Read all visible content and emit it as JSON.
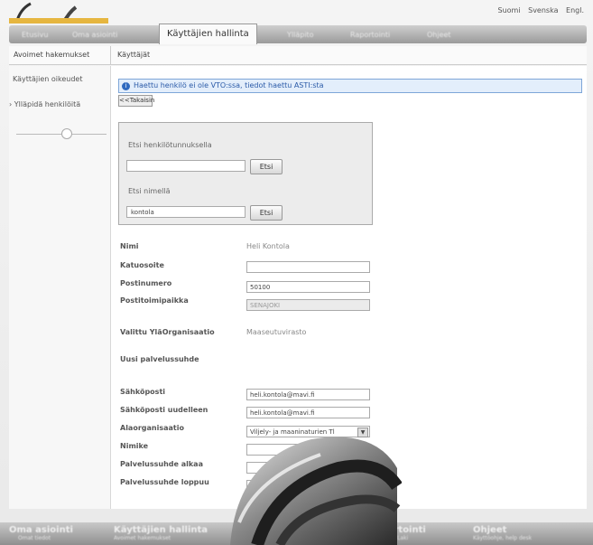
{
  "header": {
    "languages": [
      "Suomi",
      "Svenska",
      "Engl."
    ]
  },
  "tabs": [
    {
      "label": "Etusivu",
      "active": false
    },
    {
      "label": "Oma asiointi",
      "active": false
    },
    {
      "label": "Käyttäjien hallinta",
      "active": true
    },
    {
      "label": "Ylläpito",
      "active": false
    },
    {
      "label": "Raportointi",
      "active": false
    },
    {
      "label": "Ohjeet",
      "active": false
    }
  ],
  "subnav": {
    "items": [
      "Avoimet hakemukset",
      "Käyttäjät"
    ]
  },
  "sidebar": {
    "items": [
      "Käyttäjien oikeudet",
      "Ylläpidä henkilöitä"
    ]
  },
  "info": {
    "message": "Haettu henkilö ei ole VTO:ssa, tiedot haettu ASTI:sta"
  },
  "back_button": "<<Takaisin",
  "search": {
    "by_id_label": "Etsi henkilötunnuksella",
    "by_id_value": "",
    "by_name_label": "Etsi nimellä",
    "by_name_value": "kontola",
    "button_label": "Etsi"
  },
  "form": {
    "name_label": "Nimi",
    "name_value": "Heli Kontola",
    "address_label": "Katuosoite",
    "address_value": "",
    "postal_code_label": "Postinumero",
    "postal_code_value": "50100",
    "post_office_label": "Postitoimipaikka",
    "post_office_value": "SENAJOKI",
    "org_label": "Valittu YläOrganisaatio",
    "org_value": "Maaseutuvirasto",
    "new_relation_label": "Uusi palvelussuhde",
    "email_label": "Sähköposti",
    "email_value": "heli.kontola@mavi.fi",
    "email_confirm_label": "Sähköposti uudelleen",
    "email_confirm_value": "heli.kontola@mavi.fi",
    "sub_org_label": "Alaorganisaatio",
    "sub_org_value": "Viljely- ja maaninaturien Tl",
    "title_label": "Nimike",
    "title_value": "",
    "start_label": "Palvelussuhde alkaa",
    "end_label": "Palvelussuhde loppuu"
  },
  "footer": {
    "items": [
      {
        "title": "Oma asiointi",
        "subtitle": "Omat tiedot"
      },
      {
        "title": "Käyttäjien hallinta",
        "subtitle": "Avoimet hakemukset"
      },
      {
        "title": "Raportointi",
        "subtitle": "Laki"
      },
      {
        "title": "Ohjeet",
        "subtitle": "Käyttöohje, help desk"
      }
    ]
  },
  "colors": {
    "info_bg": "#e3eefb",
    "info_border": "#7ea6d8",
    "tabbar": "#9a9a9a"
  }
}
